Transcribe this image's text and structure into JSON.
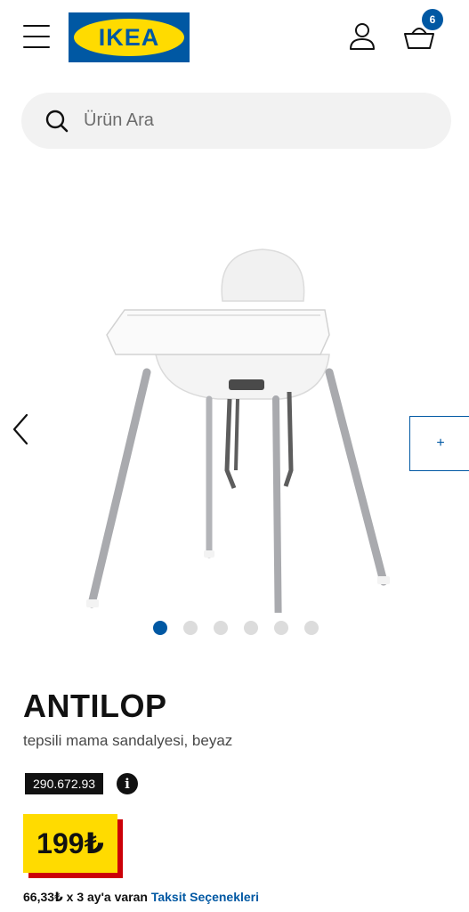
{
  "header": {
    "logo_text": "IKEA",
    "cart_count": "6",
    "brand_colors": {
      "blue": "#0058a3",
      "yellow": "#ffdb00"
    },
    "icons": [
      "menu-icon",
      "user-icon",
      "basket-icon"
    ]
  },
  "search": {
    "placeholder": "Ürün Ara",
    "icon": "search-icon"
  },
  "gallery": {
    "image": "high chair with tray, white with silver-colour legs",
    "slide_count": 6,
    "active_slide": 1,
    "add_button": "+"
  },
  "product": {
    "name": "ANTILOP",
    "description": "tepsili mama sandalyesi, beyaz",
    "article_number": "290.672.93",
    "price": "199₺",
    "price_colors": {
      "background": "#ffdb00",
      "shadow": "#cc0008"
    },
    "installment_text": "66,33₺ x 3 ay'a varan",
    "installment_link": "Taksit Seçenekleri"
  }
}
